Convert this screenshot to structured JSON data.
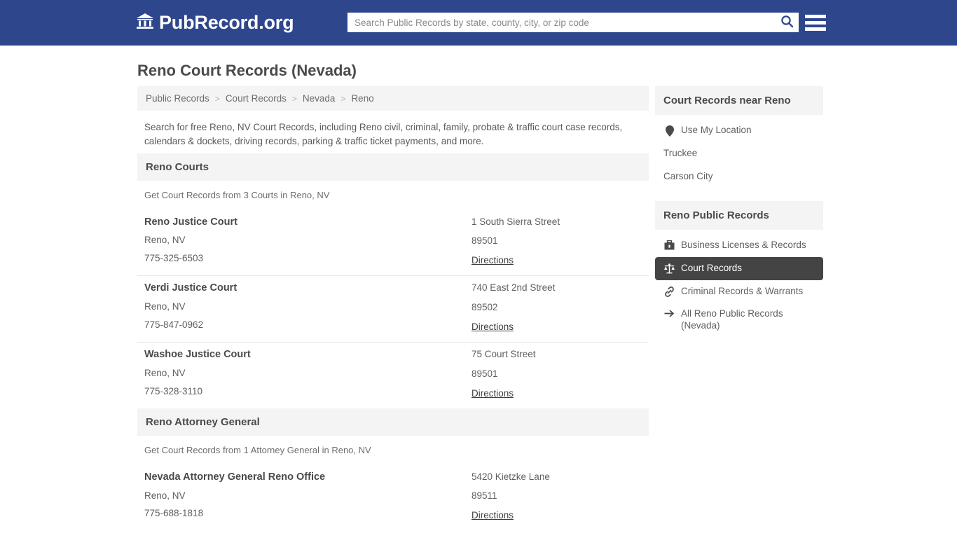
{
  "header": {
    "brand_name": "PubRecord.org",
    "brand_icon": "bank-icon",
    "search": {
      "placeholder": "Search Public Records by state, county, city, or zip code",
      "value": "",
      "icon": "search-icon"
    },
    "menu_icon": "hamburger-menu-icon",
    "background_color": "#2e468c"
  },
  "page": {
    "title": "Reno Court Records (Nevada)",
    "breadcrumb": [
      "Public Records",
      "Court Records",
      "Nevada",
      "Reno"
    ],
    "breadcrumb_separator": ">",
    "intro": "Search for free Reno, NV Court Records, including Reno civil, criminal, family, probate & traffic court case records, calendars & dockets, driving records, parking & traffic ticket payments, and more."
  },
  "sections": [
    {
      "heading": "Reno Courts",
      "note": "Get Court Records from 3 Courts in Reno, NV",
      "entries": [
        {
          "name": "Reno Justice Court",
          "city_state": "Reno, NV",
          "phone": "775-325-6503",
          "address": "1 South Sierra Street",
          "zip": "89501",
          "directions_label": "Directions"
        },
        {
          "name": "Verdi Justice Court",
          "city_state": "Reno, NV",
          "phone": "775-847-0962",
          "address": "740 East 2nd Street",
          "zip": "89502",
          "directions_label": "Directions"
        },
        {
          "name": "Washoe Justice Court",
          "city_state": "Reno, NV",
          "phone": "775-328-3110",
          "address": "75 Court Street",
          "zip": "89501",
          "directions_label": "Directions"
        }
      ]
    },
    {
      "heading": "Reno Attorney General",
      "note": "Get Court Records from 1 Attorney General in Reno, NV",
      "entries": [
        {
          "name": "Nevada Attorney General Reno Office",
          "city_state": "Reno, NV",
          "phone": "775-688-1818",
          "address": "5420 Kietzke Lane",
          "zip": "89511",
          "directions_label": "Directions"
        }
      ]
    }
  ],
  "sidebar": {
    "near_box": {
      "heading": "Court Records near Reno",
      "items": [
        {
          "label": "Use My Location",
          "icon": "map-pin-icon"
        },
        {
          "label": "Truckee",
          "icon": ""
        },
        {
          "label": "Carson City",
          "icon": ""
        }
      ]
    },
    "records_box": {
      "heading": "Reno Public Records",
      "active_color": "#444444",
      "items": [
        {
          "label": "Business Licenses & Records",
          "icon": "briefcase-icon",
          "active": false
        },
        {
          "label": "Court Records",
          "icon": "scales-of-justice-icon",
          "active": true
        },
        {
          "label": "Criminal Records & Warrants",
          "icon": "chain-link-icon",
          "active": false
        },
        {
          "label": "All Reno Public Records (Nevada)",
          "icon": "arrow-right-icon",
          "active": false
        }
      ]
    }
  }
}
